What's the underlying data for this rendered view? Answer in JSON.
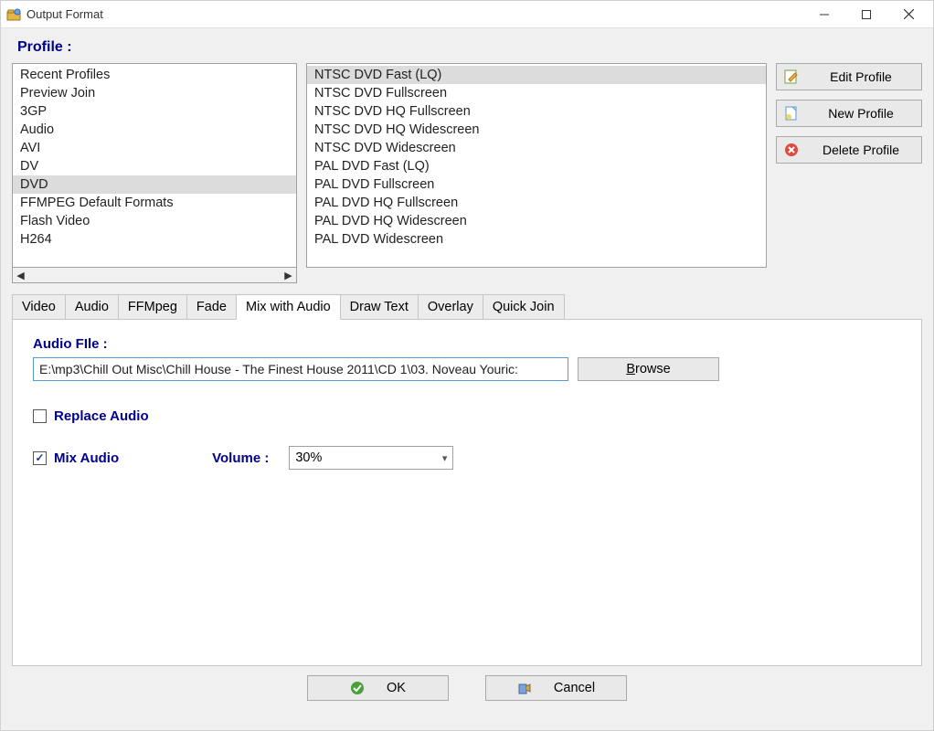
{
  "window": {
    "title": "Output Format"
  },
  "section_label": "Profile :",
  "categories": {
    "items": [
      "Recent Profiles",
      "Preview Join",
      "3GP",
      "Audio",
      "AVI",
      "DV",
      "DVD",
      "FFMPEG Default Formats",
      "Flash Video",
      "H264"
    ],
    "selected": "DVD"
  },
  "profiles": {
    "items": [
      "NTSC DVD Fast (LQ)",
      "NTSC DVD Fullscreen",
      "NTSC DVD HQ Fullscreen",
      "NTSC DVD HQ Widescreen",
      "NTSC DVD Widescreen",
      "PAL DVD Fast (LQ)",
      "PAL DVD Fullscreen",
      "PAL DVD HQ Fullscreen",
      "PAL DVD HQ Widescreen",
      "PAL DVD Widescreen"
    ],
    "selected": "NTSC DVD Fast (LQ)"
  },
  "side_buttons": {
    "edit": "Edit Profile",
    "new": "New Profile",
    "delete": "Delete Profile"
  },
  "tabs": {
    "items": [
      "Video",
      "Audio",
      "FFMpeg",
      "Fade",
      "Mix with Audio",
      "Draw Text",
      "Overlay",
      "Quick Join"
    ],
    "active": "Mix with Audio"
  },
  "mix_panel": {
    "audio_file_label": "Audio FIle :",
    "audio_file_value": "E:\\mp3\\Chill Out Misc\\Chill House - The Finest House 2011\\CD 1\\03. Noveau Youric:",
    "browse_label": "Browse",
    "replace_label": "Replace Audio",
    "replace_checked": false,
    "mix_label": "Mix Audio",
    "mix_checked": true,
    "volume_label": "Volume :",
    "volume_value": "30%"
  },
  "bottom": {
    "ok": "OK",
    "cancel": "Cancel"
  }
}
